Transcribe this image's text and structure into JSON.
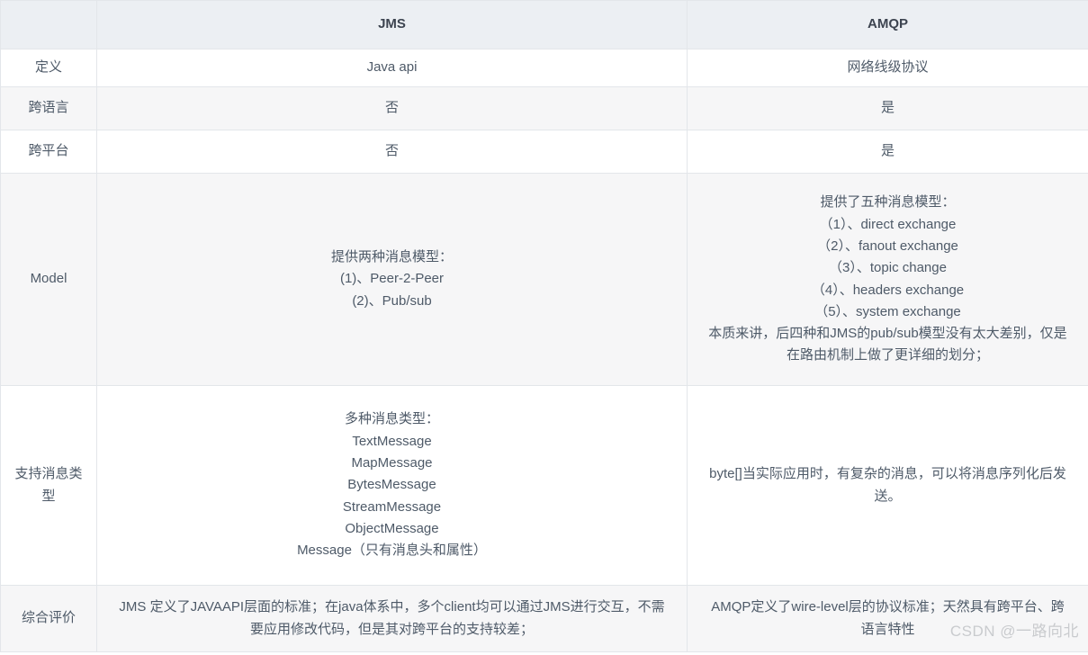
{
  "table": {
    "columns": [
      {
        "key": "label",
        "header": ""
      },
      {
        "key": "jms",
        "header": "JMS"
      },
      {
        "key": "amqp",
        "header": "AMQP"
      }
    ],
    "rows": [
      {
        "label": "定义",
        "jms_lines": [
          "Java api"
        ],
        "amqp_lines": [
          "网络线级协议"
        ]
      },
      {
        "label": "跨语言",
        "jms_lines": [
          "否"
        ],
        "amqp_lines": [
          "是"
        ]
      },
      {
        "label": "跨平台",
        "jms_lines": [
          "否"
        ],
        "amqp_lines": [
          "是"
        ]
      },
      {
        "label": "Model",
        "jms_lines": [
          "提供两种消息模型：",
          "(1)、Peer-2-Peer",
          "(2)、Pub/sub"
        ],
        "amqp_lines": [
          "提供了五种消息模型：",
          "（1）、direct exchange",
          "（2）、fanout exchange",
          "（3）、topic change",
          "（4）、headers exchange",
          "（5）、system exchange"
        ],
        "amqp_paragraph": "本质来讲，后四种和JMS的pub/sub模型没有太大差别，仅是在路由机制上做了更详细的划分；"
      },
      {
        "label": "支持消息类型",
        "jms_lines": [
          "多种消息类型：",
          "TextMessage",
          "MapMessage",
          "BytesMessage",
          "StreamMessage",
          "ObjectMessage",
          "Message（只有消息头和属性）"
        ],
        "amqp_paragraph": "byte[]当实际应用时，有复杂的消息，可以将消息序列化后发送。"
      },
      {
        "label": "综合评价",
        "jms_paragraph": "JMS 定义了JAVAAPI层面的标准；在java体系中，多个client均可以通过JMS进行交互，不需要应用修改代码，但是其对跨平台的支持较差；",
        "amqp_paragraph": "AMQP定义了wire-level层的协议标准；天然具有跨平台、跨语言特性"
      }
    ]
  },
  "watermark": {
    "text": "CSDN @一路向北",
    "color": "#c9cbce"
  },
  "colors": {
    "header_bg": "#eceff3",
    "stripe_bg": "#f6f6f7",
    "plain_bg": "#ffffff",
    "border": "#e3e6ea",
    "text": "#4e5a68"
  }
}
